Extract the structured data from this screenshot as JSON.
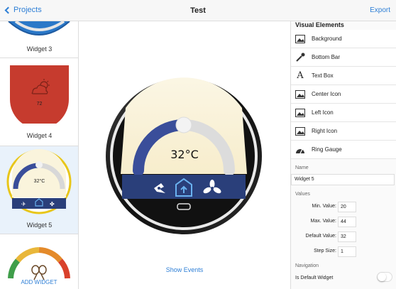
{
  "nav": {
    "back_label": "Projects",
    "title": "Test",
    "export_label": "Export"
  },
  "widgets": [
    {
      "label": "Widget 3"
    },
    {
      "label": "Widget 4",
      "temp": "72"
    },
    {
      "label": "Widget 5",
      "temp": "32°C"
    }
  ],
  "add_widget": "ADD WIDGET",
  "preview": {
    "temp": "32°C",
    "show_events": "Show Events"
  },
  "visual_elements": {
    "title": "Visual Elements",
    "items": [
      {
        "label": "Background",
        "icon": "image-icon"
      },
      {
        "label": "Bottom Bar",
        "icon": "eyedropper-icon"
      },
      {
        "label": "Text Box",
        "icon": "text-icon"
      },
      {
        "label": "Center Icon",
        "icon": "image-icon"
      },
      {
        "label": "Left Icon",
        "icon": "image-icon"
      },
      {
        "label": "Right Icon",
        "icon": "image-icon"
      },
      {
        "label": "Ring Gauge",
        "icon": "gauge-icon"
      }
    ]
  },
  "properties": {
    "name_label": "Name",
    "name_value": "Widget 5",
    "values_label": "Values",
    "min_label": "Min. Value:",
    "min_value": "20",
    "max_label": "Max. Value:",
    "max_value": "44",
    "default_label": "Default Value:",
    "default_value": "32",
    "step_label": "Step Size:",
    "step_value": "1",
    "navigation_label": "Navigation",
    "default_widget_label": "Is Default Widget"
  },
  "colors": {
    "accent": "#2e7fd6",
    "selected_border": "#e8c61a",
    "widget4_bg": "#c63b2e",
    "gauge_blue": "#3a4e9a"
  }
}
